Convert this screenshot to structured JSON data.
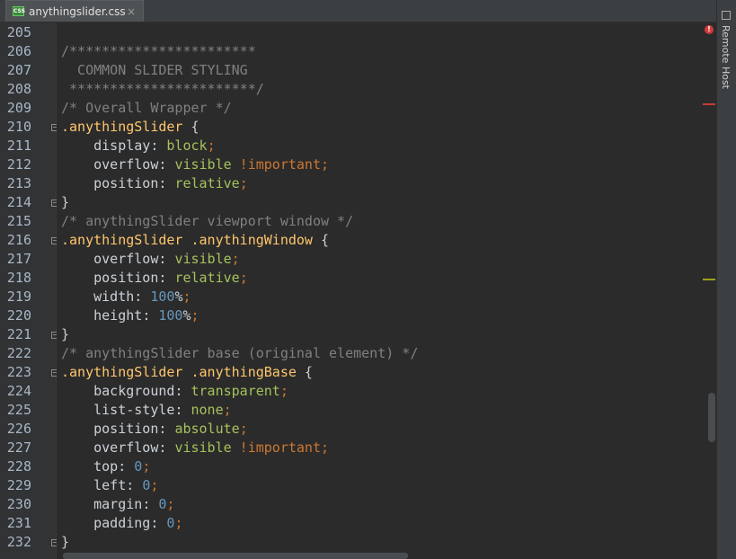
{
  "tab": {
    "filename": "anythingslider.css",
    "icon": "css-file-icon",
    "close": "×"
  },
  "sidebar": {
    "label": "Remote Host"
  },
  "colors": {
    "background": "#2b2b2b",
    "selector": "#ffc66d",
    "value": "#a5c25c",
    "number": "#6897bb",
    "comment": "#808080"
  },
  "lines": [
    {
      "n": "205",
      "tokens": []
    },
    {
      "n": "206",
      "tokens": [
        {
          "t": "/***********************",
          "k": "comment"
        }
      ]
    },
    {
      "n": "207",
      "tokens": [
        {
          "t": "  COMMON SLIDER STYLING",
          "k": "comment"
        }
      ]
    },
    {
      "n": "208",
      "tokens": [
        {
          "t": " ***********************/",
          "k": "comment"
        }
      ]
    },
    {
      "n": "209",
      "tokens": [
        {
          "t": "/* Overall Wrapper */",
          "k": "comment"
        }
      ]
    },
    {
      "n": "210",
      "fold": "open",
      "tokens": [
        {
          "t": ".anythingSlider",
          "k": "sel"
        },
        {
          "t": " {",
          "k": "plain"
        }
      ]
    },
    {
      "n": "211",
      "tokens": [
        {
          "t": "    display",
          "k": "prop"
        },
        {
          "t": ": ",
          "k": "plain"
        },
        {
          "t": "block",
          "k": "val"
        },
        {
          "t": ";",
          "k": "punct"
        }
      ]
    },
    {
      "n": "212",
      "tokens": [
        {
          "t": "    overflow",
          "k": "prop"
        },
        {
          "t": ": ",
          "k": "plain"
        },
        {
          "t": "visible",
          "k": "val"
        },
        {
          "t": " !important",
          "k": "imp"
        },
        {
          "t": ";",
          "k": "punct"
        }
      ]
    },
    {
      "n": "213",
      "tokens": [
        {
          "t": "    position",
          "k": "prop"
        },
        {
          "t": ": ",
          "k": "plain"
        },
        {
          "t": "relative",
          "k": "val"
        },
        {
          "t": ";",
          "k": "punct"
        }
      ]
    },
    {
      "n": "214",
      "fold": "close",
      "tokens": [
        {
          "t": "}",
          "k": "plain"
        }
      ]
    },
    {
      "n": "215",
      "tokens": [
        {
          "t": "/* anythingSlider viewport window */",
          "k": "comment"
        }
      ]
    },
    {
      "n": "216",
      "fold": "open",
      "tokens": [
        {
          "t": ".anythingSlider",
          "k": "sel"
        },
        {
          "t": " ",
          "k": "plain"
        },
        {
          "t": ".anythingWindow",
          "k": "sel"
        },
        {
          "t": " {",
          "k": "plain"
        }
      ]
    },
    {
      "n": "217",
      "tokens": [
        {
          "t": "    overflow",
          "k": "prop"
        },
        {
          "t": ": ",
          "k": "plain"
        },
        {
          "t": "visible",
          "k": "val"
        },
        {
          "t": ";",
          "k": "punct"
        }
      ]
    },
    {
      "n": "218",
      "tokens": [
        {
          "t": "    position",
          "k": "prop"
        },
        {
          "t": ": ",
          "k": "plain"
        },
        {
          "t": "relative",
          "k": "val"
        },
        {
          "t": ";",
          "k": "punct"
        }
      ]
    },
    {
      "n": "219",
      "tokens": [
        {
          "t": "    width",
          "k": "prop"
        },
        {
          "t": ": ",
          "k": "plain"
        },
        {
          "t": "100",
          "k": "num"
        },
        {
          "t": "%",
          "k": "plain"
        },
        {
          "t": ";",
          "k": "punct"
        }
      ]
    },
    {
      "n": "220",
      "tokens": [
        {
          "t": "    height",
          "k": "prop"
        },
        {
          "t": ": ",
          "k": "plain"
        },
        {
          "t": "100",
          "k": "num"
        },
        {
          "t": "%",
          "k": "plain"
        },
        {
          "t": ";",
          "k": "punct"
        }
      ]
    },
    {
      "n": "221",
      "fold": "close",
      "tokens": [
        {
          "t": "}",
          "k": "plain"
        }
      ]
    },
    {
      "n": "222",
      "tokens": [
        {
          "t": "/* anythingSlider base (original element) */",
          "k": "comment"
        }
      ]
    },
    {
      "n": "223",
      "fold": "open",
      "tokens": [
        {
          "t": ".anythingSlider",
          "k": "sel"
        },
        {
          "t": " ",
          "k": "plain"
        },
        {
          "t": ".anythingBase",
          "k": "sel"
        },
        {
          "t": " {",
          "k": "plain"
        }
      ]
    },
    {
      "n": "224",
      "tokens": [
        {
          "t": "    background",
          "k": "prop"
        },
        {
          "t": ": ",
          "k": "plain"
        },
        {
          "t": "transparent",
          "k": "val"
        },
        {
          "t": ";",
          "k": "punct"
        }
      ]
    },
    {
      "n": "225",
      "tokens": [
        {
          "t": "    list-style",
          "k": "prop"
        },
        {
          "t": ": ",
          "k": "plain"
        },
        {
          "t": "none",
          "k": "val"
        },
        {
          "t": ";",
          "k": "punct"
        }
      ]
    },
    {
      "n": "226",
      "tokens": [
        {
          "t": "    position",
          "k": "prop"
        },
        {
          "t": ": ",
          "k": "plain"
        },
        {
          "t": "absolute",
          "k": "val"
        },
        {
          "t": ";",
          "k": "punct"
        }
      ]
    },
    {
      "n": "227",
      "tokens": [
        {
          "t": "    overflow",
          "k": "prop"
        },
        {
          "t": ": ",
          "k": "plain"
        },
        {
          "t": "visible",
          "k": "val"
        },
        {
          "t": " !important",
          "k": "imp"
        },
        {
          "t": ";",
          "k": "punct"
        }
      ]
    },
    {
      "n": "228",
      "tokens": [
        {
          "t": "    top",
          "k": "prop"
        },
        {
          "t": ": ",
          "k": "plain"
        },
        {
          "t": "0",
          "k": "num"
        },
        {
          "t": ";",
          "k": "punct"
        }
      ]
    },
    {
      "n": "229",
      "tokens": [
        {
          "t": "    left",
          "k": "prop"
        },
        {
          "t": ": ",
          "k": "plain"
        },
        {
          "t": "0",
          "k": "num"
        },
        {
          "t": ";",
          "k": "punct"
        }
      ]
    },
    {
      "n": "230",
      "tokens": [
        {
          "t": "    margin",
          "k": "prop"
        },
        {
          "t": ": ",
          "k": "plain"
        },
        {
          "t": "0",
          "k": "num"
        },
        {
          "t": ";",
          "k": "punct"
        }
      ]
    },
    {
      "n": "231",
      "tokens": [
        {
          "t": "    padding",
          "k": "prop"
        },
        {
          "t": ": ",
          "k": "plain"
        },
        {
          "t": "0",
          "k": "num"
        },
        {
          "t": ";",
          "k": "punct"
        }
      ]
    },
    {
      "n": "232",
      "fold": "close",
      "tokens": [
        {
          "t": "}",
          "k": "plain"
        }
      ]
    }
  ]
}
